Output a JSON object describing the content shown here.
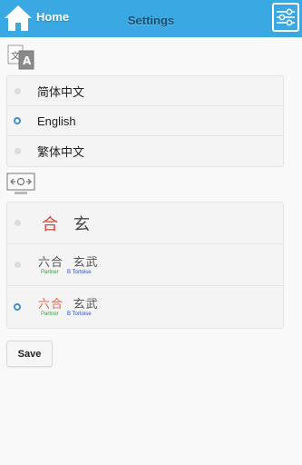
{
  "header": {
    "home_label": "Home",
    "title": "Settings",
    "accent": "#3aa8e2"
  },
  "language": {
    "icon": "translate-icon",
    "options": [
      {
        "label": "简体中文",
        "selected": false
      },
      {
        "label": "English",
        "selected": true
      },
      {
        "label": "繁体中文",
        "selected": false
      }
    ]
  },
  "display": {
    "icon": "display-mode-icon",
    "options": [
      {
        "chars": [
          "合",
          "玄"
        ],
        "subs": [],
        "selected": false
      },
      {
        "chars": [
          "六合",
          "玄武"
        ],
        "subs": [
          "Partner",
          "B Tortoise"
        ],
        "selected": false
      },
      {
        "chars": [
          "六合",
          "玄武"
        ],
        "subs": [
          "Partner",
          "B Tortoise"
        ],
        "selected": true
      }
    ]
  },
  "save_label": "Save"
}
